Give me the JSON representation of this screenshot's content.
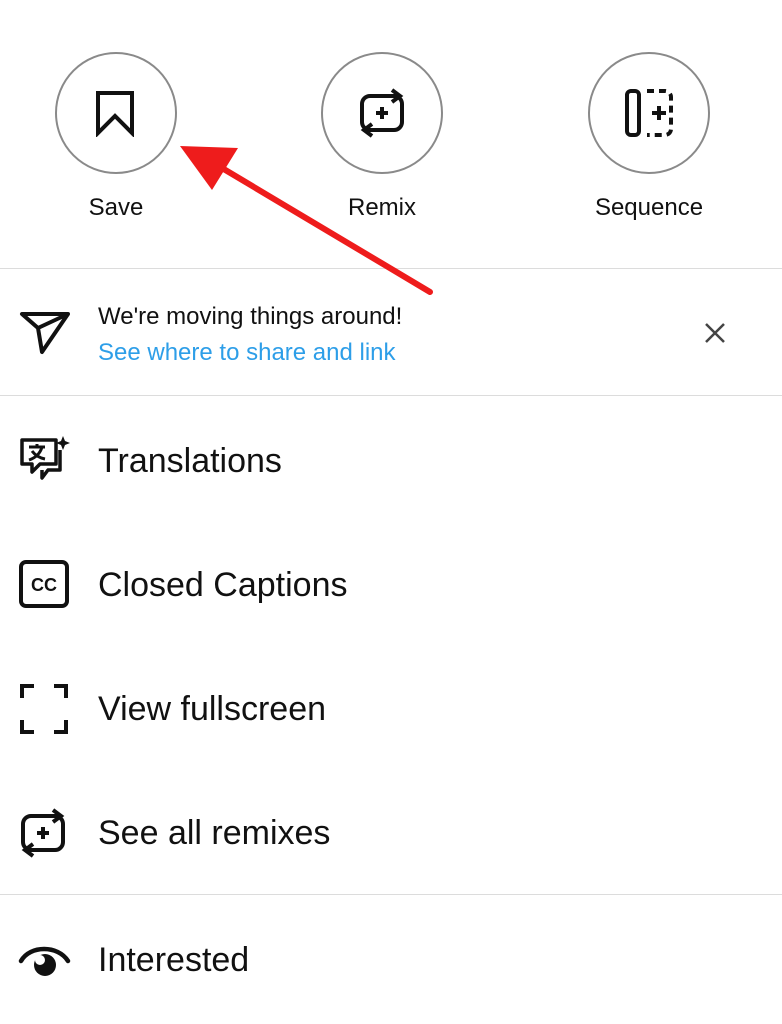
{
  "actions": [
    {
      "label": "Save",
      "icon": "bookmark-icon"
    },
    {
      "label": "Remix",
      "icon": "remix-icon"
    },
    {
      "label": "Sequence",
      "icon": "sequence-icon"
    }
  ],
  "banner": {
    "title": "We're moving things around!",
    "link": "See where to share and link",
    "icon": "send-icon"
  },
  "menu": [
    {
      "label": "Translations",
      "icon": "translate-icon"
    },
    {
      "label": "Closed Captions",
      "icon": "closed-captions-icon"
    },
    {
      "label": "View fullscreen",
      "icon": "fullscreen-icon"
    },
    {
      "label": "See all remixes",
      "icon": "remix-icon"
    },
    {
      "label": "Interested",
      "icon": "eye-icon"
    }
  ],
  "colors": {
    "link": "#2d9ee8",
    "annotation_arrow": "#ee1c1c"
  }
}
